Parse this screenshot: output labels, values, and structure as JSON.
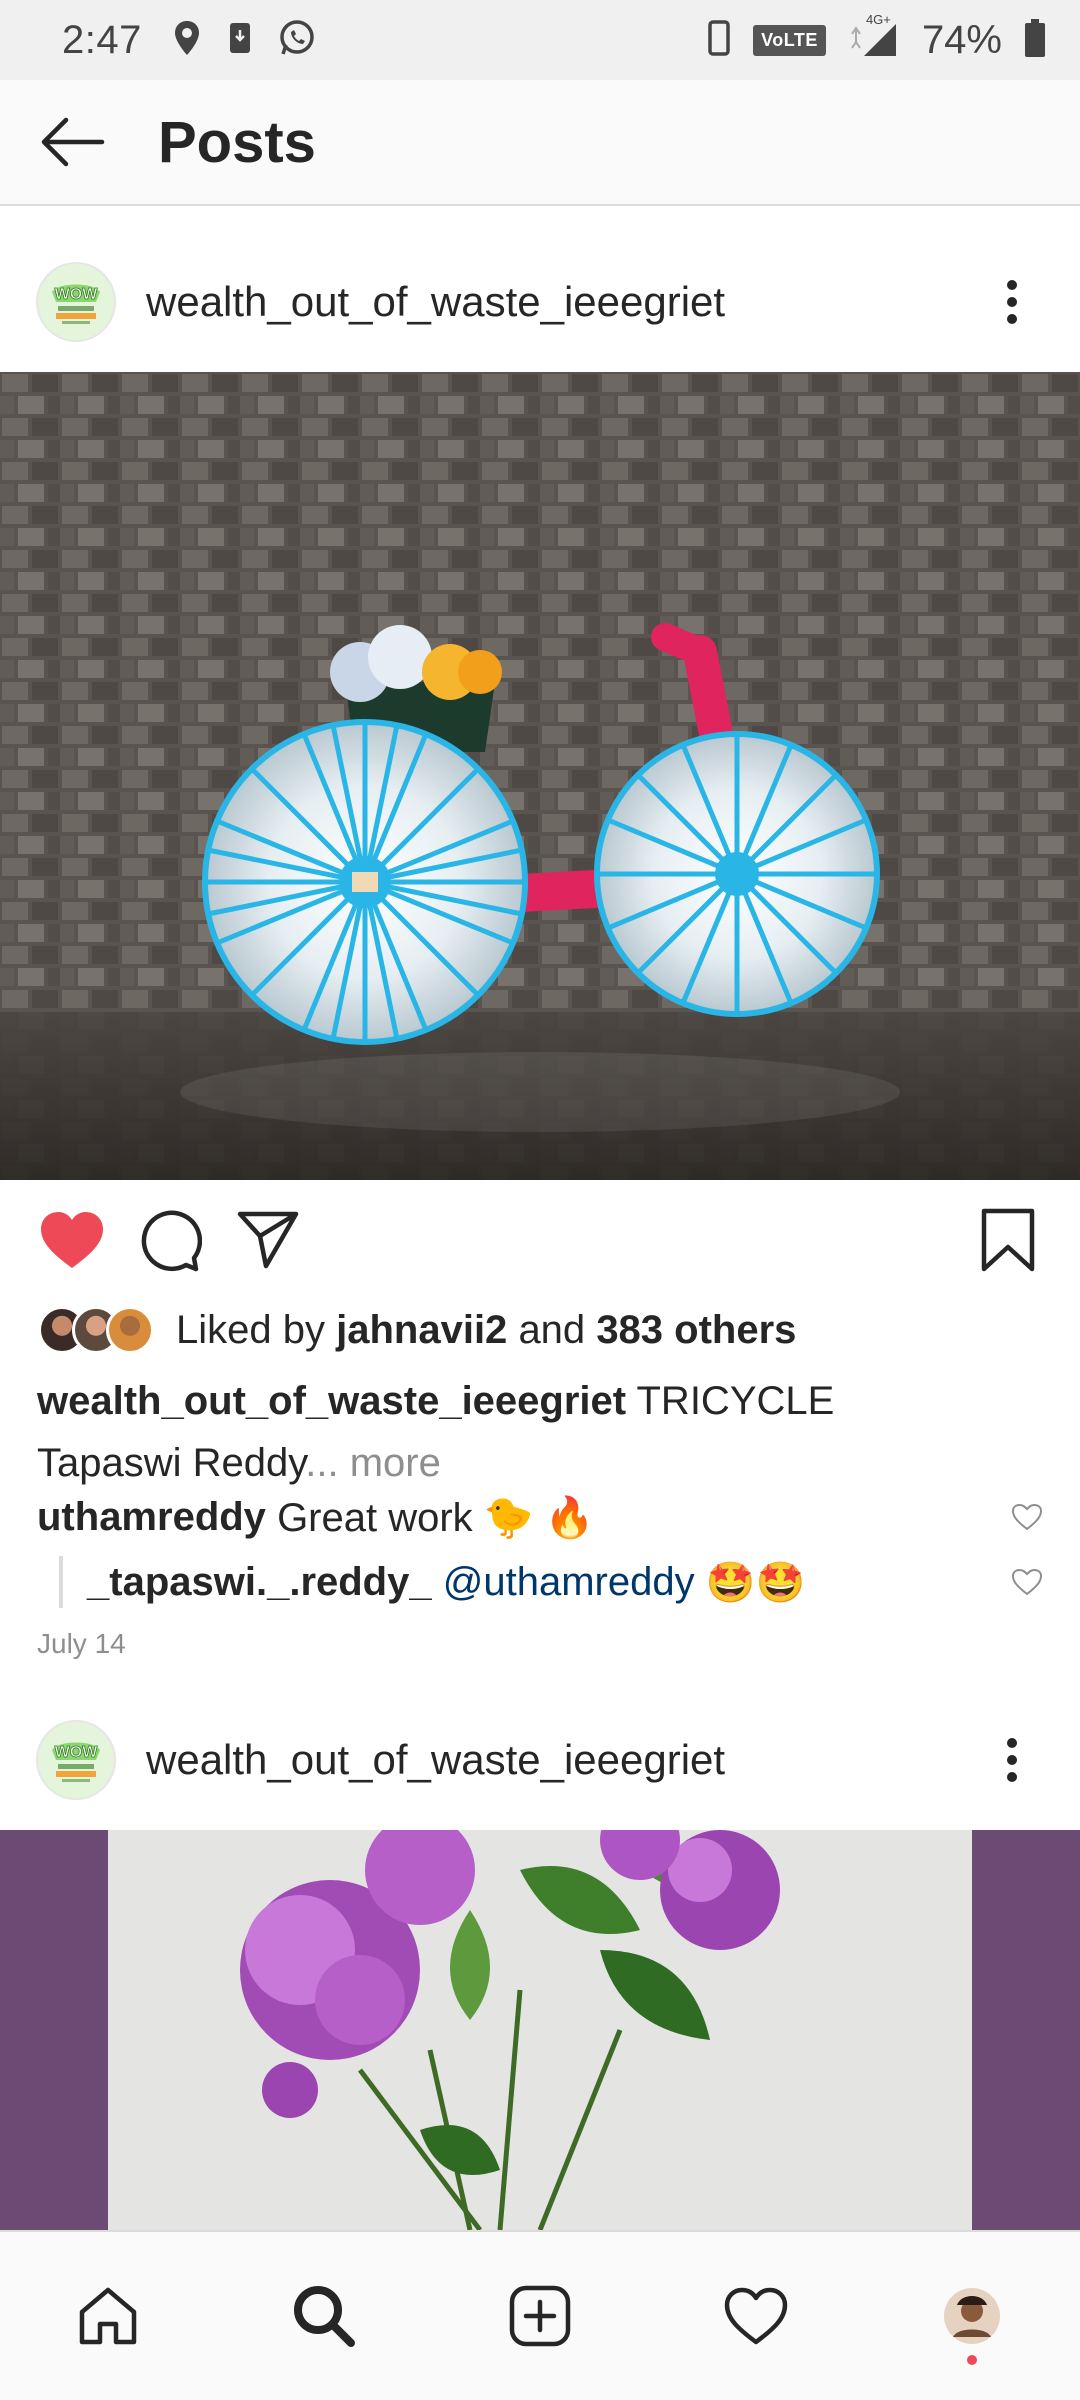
{
  "status_bar": {
    "time": "2:47",
    "network_label": "VoLTE",
    "network_type": "4G+",
    "battery_percent": "74%",
    "icons": [
      "location-icon",
      "download-notification-icon",
      "whatsapp-icon",
      "phone-icon",
      "signal-icon",
      "battery-icon"
    ]
  },
  "header": {
    "title": "Posts",
    "back_icon": "arrow-left-icon"
  },
  "posts": [
    {
      "username": "wealth_out_of_waste_ieeegriet",
      "avatar_text": "WOW",
      "image_alt": "Bicycle made of CDs and yarn",
      "liked": true,
      "likes": {
        "prefix": "Liked by",
        "user": "jahnavii2",
        "connector": "and",
        "others": "383 others"
      },
      "caption": {
        "username": "wealth_out_of_waste_ieeegriet",
        "text_line1": "TRICYCLE",
        "text_line2": "Tapaswi Reddy",
        "more": "... more"
      },
      "comments": [
        {
          "username": "uthamreddy",
          "text": "Great work 🐤 🔥"
        },
        {
          "username": "_tapaswi._.reddy_",
          "mention": "@uthamreddy",
          "text": "🤩🤩"
        }
      ],
      "date": "July 14"
    },
    {
      "username": "wealth_out_of_waste_ieeegriet",
      "avatar_text": "WOW",
      "image_alt": "Purple paper flowers bouquet"
    }
  ],
  "colors": {
    "like_red": "#ed4956",
    "text": "#262626",
    "muted": "#8e8e8e",
    "mention": "#00376b",
    "yarn_blue": "#29b6e6",
    "yarn_pink": "#e0245e"
  },
  "bottom_nav": [
    {
      "name": "home",
      "icon": "home-icon"
    },
    {
      "name": "search",
      "icon": "search-icon"
    },
    {
      "name": "new-post",
      "icon": "add-post-icon"
    },
    {
      "name": "activity",
      "icon": "heart-icon"
    },
    {
      "name": "profile",
      "icon": "profile-avatar-icon"
    }
  ]
}
